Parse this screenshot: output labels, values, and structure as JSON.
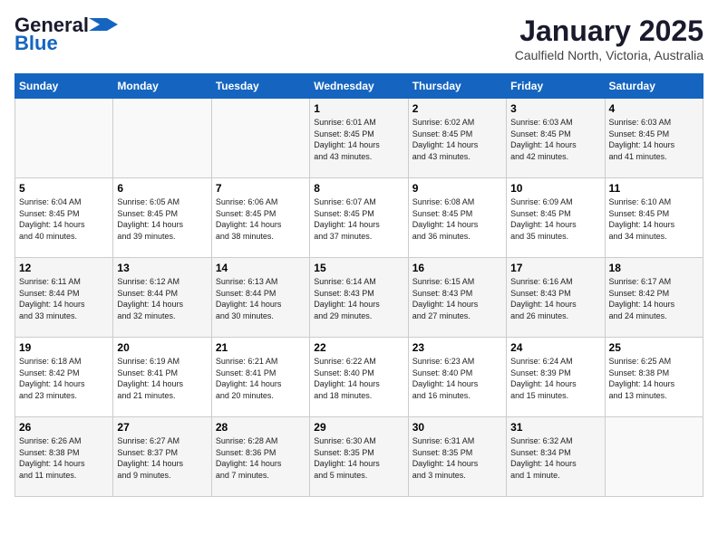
{
  "header": {
    "logo_line1": "General",
    "logo_line2": "Blue",
    "month": "January 2025",
    "location": "Caulfield North, Victoria, Australia"
  },
  "weekdays": [
    "Sunday",
    "Monday",
    "Tuesday",
    "Wednesday",
    "Thursday",
    "Friday",
    "Saturday"
  ],
  "weeks": [
    [
      {
        "day": "",
        "info": ""
      },
      {
        "day": "",
        "info": ""
      },
      {
        "day": "",
        "info": ""
      },
      {
        "day": "1",
        "info": "Sunrise: 6:01 AM\nSunset: 8:45 PM\nDaylight: 14 hours\nand 43 minutes."
      },
      {
        "day": "2",
        "info": "Sunrise: 6:02 AM\nSunset: 8:45 PM\nDaylight: 14 hours\nand 43 minutes."
      },
      {
        "day": "3",
        "info": "Sunrise: 6:03 AM\nSunset: 8:45 PM\nDaylight: 14 hours\nand 42 minutes."
      },
      {
        "day": "4",
        "info": "Sunrise: 6:03 AM\nSunset: 8:45 PM\nDaylight: 14 hours\nand 41 minutes."
      }
    ],
    [
      {
        "day": "5",
        "info": "Sunrise: 6:04 AM\nSunset: 8:45 PM\nDaylight: 14 hours\nand 40 minutes."
      },
      {
        "day": "6",
        "info": "Sunrise: 6:05 AM\nSunset: 8:45 PM\nDaylight: 14 hours\nand 39 minutes."
      },
      {
        "day": "7",
        "info": "Sunrise: 6:06 AM\nSunset: 8:45 PM\nDaylight: 14 hours\nand 38 minutes."
      },
      {
        "day": "8",
        "info": "Sunrise: 6:07 AM\nSunset: 8:45 PM\nDaylight: 14 hours\nand 37 minutes."
      },
      {
        "day": "9",
        "info": "Sunrise: 6:08 AM\nSunset: 8:45 PM\nDaylight: 14 hours\nand 36 minutes."
      },
      {
        "day": "10",
        "info": "Sunrise: 6:09 AM\nSunset: 8:45 PM\nDaylight: 14 hours\nand 35 minutes."
      },
      {
        "day": "11",
        "info": "Sunrise: 6:10 AM\nSunset: 8:45 PM\nDaylight: 14 hours\nand 34 minutes."
      }
    ],
    [
      {
        "day": "12",
        "info": "Sunrise: 6:11 AM\nSunset: 8:44 PM\nDaylight: 14 hours\nand 33 minutes."
      },
      {
        "day": "13",
        "info": "Sunrise: 6:12 AM\nSunset: 8:44 PM\nDaylight: 14 hours\nand 32 minutes."
      },
      {
        "day": "14",
        "info": "Sunrise: 6:13 AM\nSunset: 8:44 PM\nDaylight: 14 hours\nand 30 minutes."
      },
      {
        "day": "15",
        "info": "Sunrise: 6:14 AM\nSunset: 8:43 PM\nDaylight: 14 hours\nand 29 minutes."
      },
      {
        "day": "16",
        "info": "Sunrise: 6:15 AM\nSunset: 8:43 PM\nDaylight: 14 hours\nand 27 minutes."
      },
      {
        "day": "17",
        "info": "Sunrise: 6:16 AM\nSunset: 8:43 PM\nDaylight: 14 hours\nand 26 minutes."
      },
      {
        "day": "18",
        "info": "Sunrise: 6:17 AM\nSunset: 8:42 PM\nDaylight: 14 hours\nand 24 minutes."
      }
    ],
    [
      {
        "day": "19",
        "info": "Sunrise: 6:18 AM\nSunset: 8:42 PM\nDaylight: 14 hours\nand 23 minutes."
      },
      {
        "day": "20",
        "info": "Sunrise: 6:19 AM\nSunset: 8:41 PM\nDaylight: 14 hours\nand 21 minutes."
      },
      {
        "day": "21",
        "info": "Sunrise: 6:21 AM\nSunset: 8:41 PM\nDaylight: 14 hours\nand 20 minutes."
      },
      {
        "day": "22",
        "info": "Sunrise: 6:22 AM\nSunset: 8:40 PM\nDaylight: 14 hours\nand 18 minutes."
      },
      {
        "day": "23",
        "info": "Sunrise: 6:23 AM\nSunset: 8:40 PM\nDaylight: 14 hours\nand 16 minutes."
      },
      {
        "day": "24",
        "info": "Sunrise: 6:24 AM\nSunset: 8:39 PM\nDaylight: 14 hours\nand 15 minutes."
      },
      {
        "day": "25",
        "info": "Sunrise: 6:25 AM\nSunset: 8:38 PM\nDaylight: 14 hours\nand 13 minutes."
      }
    ],
    [
      {
        "day": "26",
        "info": "Sunrise: 6:26 AM\nSunset: 8:38 PM\nDaylight: 14 hours\nand 11 minutes."
      },
      {
        "day": "27",
        "info": "Sunrise: 6:27 AM\nSunset: 8:37 PM\nDaylight: 14 hours\nand 9 minutes."
      },
      {
        "day": "28",
        "info": "Sunrise: 6:28 AM\nSunset: 8:36 PM\nDaylight: 14 hours\nand 7 minutes."
      },
      {
        "day": "29",
        "info": "Sunrise: 6:30 AM\nSunset: 8:35 PM\nDaylight: 14 hours\nand 5 minutes."
      },
      {
        "day": "30",
        "info": "Sunrise: 6:31 AM\nSunset: 8:35 PM\nDaylight: 14 hours\nand 3 minutes."
      },
      {
        "day": "31",
        "info": "Sunrise: 6:32 AM\nSunset: 8:34 PM\nDaylight: 14 hours\nand 1 minute."
      },
      {
        "day": "",
        "info": ""
      }
    ]
  ]
}
